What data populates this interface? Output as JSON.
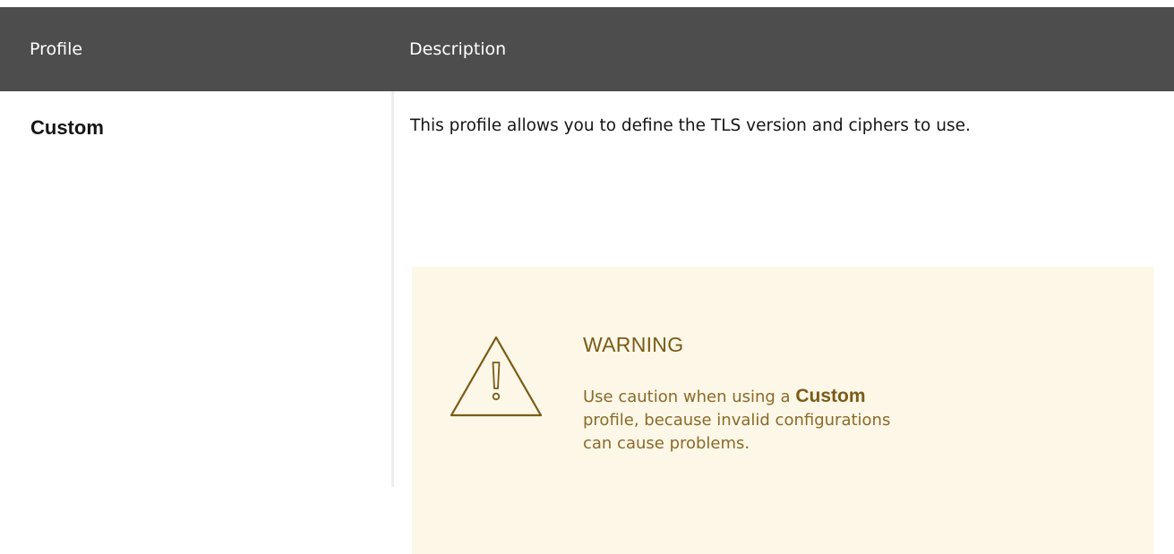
{
  "table": {
    "headers": {
      "profile": "Profile",
      "description": "Description"
    },
    "rows": [
      {
        "profile": "Custom",
        "description": "This profile allows you to define the TLS version and ciphers to use.",
        "admonition": {
          "icon": "warning-triangle-icon",
          "title": "WARNING",
          "text_before": "Use caution when using a ",
          "emphasis": "Custom",
          "text_after": " profile, because invalid configurations can cause problems."
        }
      }
    ]
  },
  "colors": {
    "header_bg": "#4d4d4d",
    "warning_bg": "#fdf7e7",
    "warning_text": "#7a5b17"
  }
}
